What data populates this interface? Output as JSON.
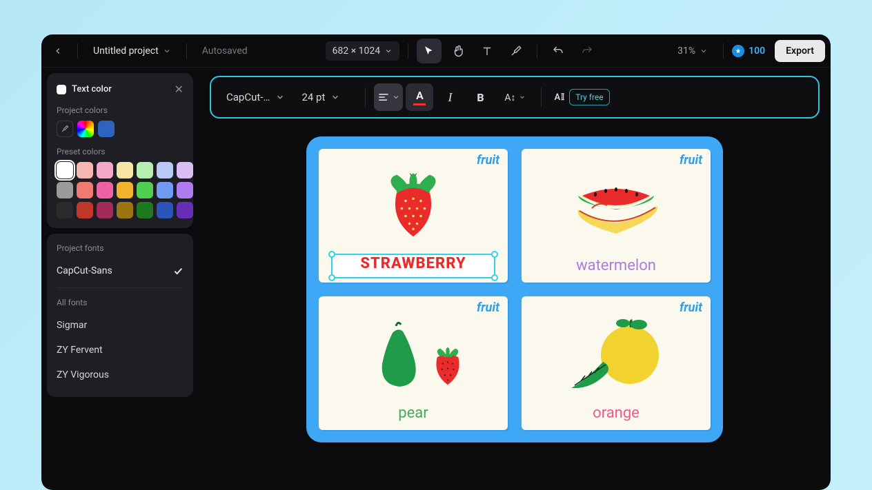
{
  "header": {
    "project_title": "Untitled project",
    "autosaved": "Autosaved",
    "dimensions": "682 × 1024",
    "zoom": "31%",
    "credits": "100",
    "export": "Export"
  },
  "text_color_panel": {
    "title": "Text color",
    "project_colors_label": "Project colors",
    "preset_colors_label": "Preset colors",
    "preset_colors": [
      "#ffffff",
      "#f6b7b2",
      "#f4a8c8",
      "#f7e6a3",
      "#b6efb1",
      "#b9c9f5",
      "#d9bff3",
      "#9b9b9b",
      "#ef7a6f",
      "#f062a5",
      "#f2b22e",
      "#4fd14f",
      "#6f9cf2",
      "#b07af2",
      "#2a2a2a",
      "#c1382a",
      "#a22c58",
      "#9c7412",
      "#1d7a1d",
      "#2b54b8",
      "#6a2db8"
    ]
  },
  "fonts_panel": {
    "project_fonts_label": "Project fonts",
    "selected_font": "CapCut-Sans",
    "all_fonts_label": "All fonts",
    "fonts": [
      "Sigmar",
      "ZY Fervent",
      "ZY Vigorous"
    ]
  },
  "text_toolbar": {
    "font_name": "CapCut-…",
    "font_size": "24 pt",
    "try_free": "Try free"
  },
  "canvas": {
    "tag": "fruit",
    "cards": {
      "strawberry": "STRAWBERRY",
      "watermelon": "watermelon",
      "pear": "pear",
      "orange": "orange"
    }
  }
}
